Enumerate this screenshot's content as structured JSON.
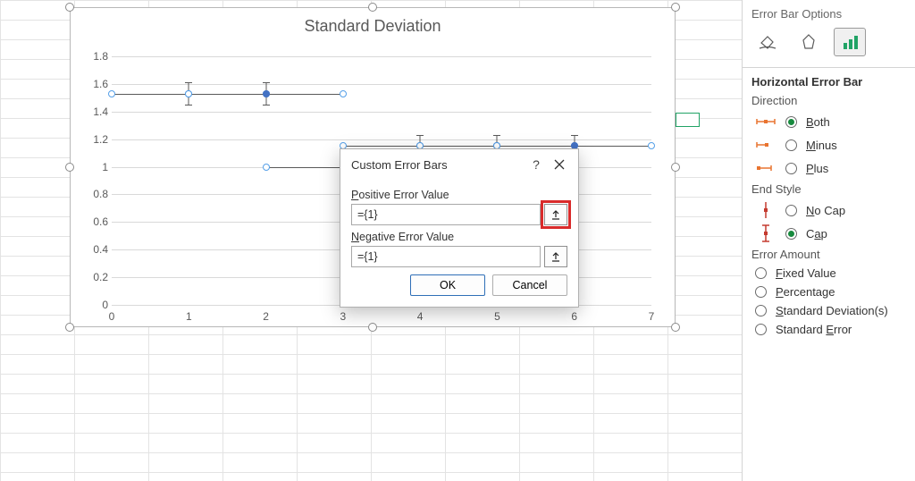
{
  "chart": {
    "title": "Standard Deviation"
  },
  "chart_data": {
    "type": "scatter",
    "xlabel": "",
    "ylabel": "",
    "xlim": [
      0,
      7
    ],
    "xticks": [
      0,
      1,
      2,
      3,
      4,
      5,
      6,
      7
    ],
    "ylim": [
      0,
      1.8
    ],
    "yticks": [
      0,
      0.2,
      0.4,
      0.6,
      0.8,
      1,
      1.2,
      1.4,
      1.6,
      1.8
    ],
    "x": [
      1,
      2,
      3,
      4,
      5,
      6
    ],
    "y": [
      1.53,
      1.53,
      1.0,
      1.15,
      1.15,
      1.15
    ],
    "error_bars": {
      "direction": "both",
      "end_style": "cap",
      "horizontal_custom": {
        "positive": 1,
        "negative": 1
      },
      "vertical_approx": 0.08
    },
    "grid": true
  },
  "dialog": {
    "title": "Custom Error Bars",
    "positive_label": "Positive Error Value",
    "negative_label": "Negative Error Value",
    "positive_value": "={1}",
    "negative_value": "={1}",
    "ok": "OK",
    "cancel": "Cancel"
  },
  "panel": {
    "options_label": "Error Bar Options",
    "section_title": "Horizontal Error Bar",
    "direction": {
      "label": "Direction",
      "both": "Both",
      "minus": "Minus",
      "plus": "Plus",
      "selected": "Both"
    },
    "end_style": {
      "label": "End Style",
      "nocap": "No Cap",
      "cap": "Cap",
      "selected": "Cap"
    },
    "error_amount": {
      "label": "Error Amount",
      "fixed": "Fixed Value",
      "percentage": "Percentage",
      "stddev": "Standard Deviation(s)",
      "stderr": "Standard Error"
    }
  }
}
